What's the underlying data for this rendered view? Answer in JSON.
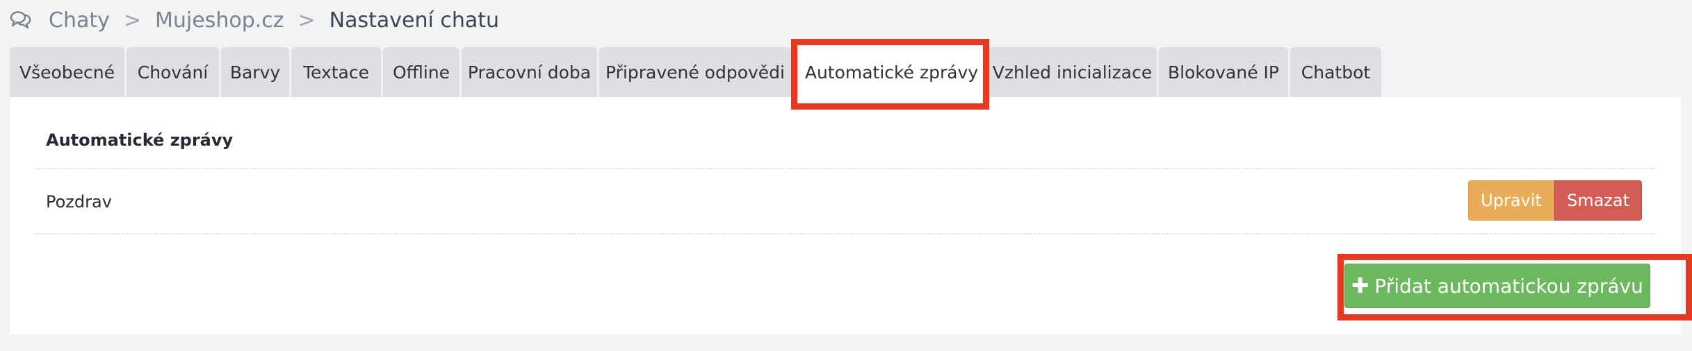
{
  "breadcrumb": {
    "icon": "chat-bubbles-icon",
    "items": [
      "Chaty",
      "Mujeshop.cz"
    ],
    "separator": ">",
    "current": "Nastavení chatu"
  },
  "tabs": [
    {
      "label": "Všeobecné"
    },
    {
      "label": "Chování"
    },
    {
      "label": "Barvy"
    },
    {
      "label": "Textace"
    },
    {
      "label": "Offline"
    },
    {
      "label": "Pracovní doba"
    },
    {
      "label": "Připravené odpovědi"
    },
    {
      "label": "Automatické zprávy",
      "active": true
    },
    {
      "label": "Vzhled inicializace"
    },
    {
      "label": "Blokované IP"
    },
    {
      "label": "Chatbot"
    }
  ],
  "panel": {
    "title": "Automatické zprávy",
    "rows": [
      {
        "name": "Pozdrav",
        "edit_label": "Upravit",
        "delete_label": "Smazat"
      }
    ],
    "add_button": {
      "icon": "plus-icon",
      "label": "Přidat automatickou zprávu"
    }
  },
  "colors": {
    "background": "#f2f3f5",
    "tab_inactive": "#dedfe2",
    "edit_button": "#e9ad57",
    "delete_button": "#d55b57",
    "add_button": "#6cb85f",
    "highlight": "#e43a22"
  }
}
